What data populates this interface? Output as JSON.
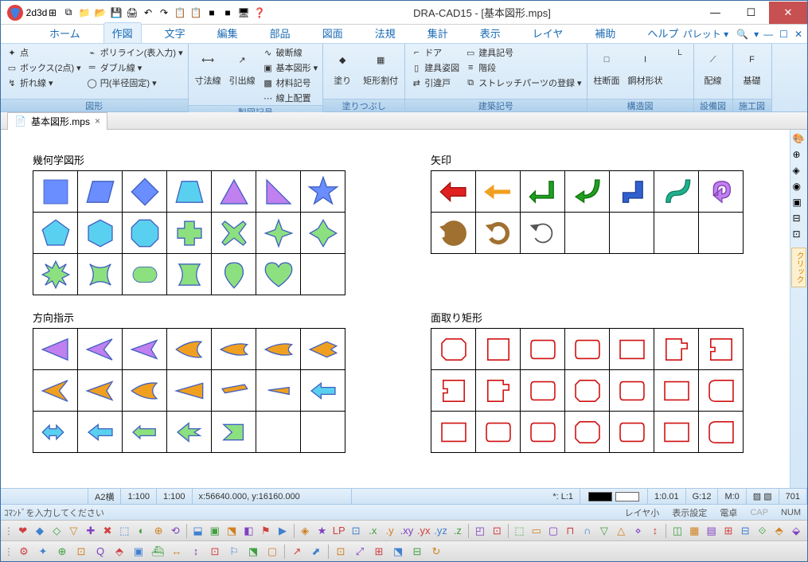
{
  "window": {
    "title": "DRA-CAD15 - [基本図形.mps]",
    "min": "—",
    "max": "☐",
    "close": "✕"
  },
  "qat": [
    "2d3d",
    "⊞",
    "⧉",
    "📁",
    "📂",
    "💾",
    "🖨",
    "↶",
    "↷",
    "📋",
    "📋",
    "■",
    "■",
    "🖥",
    "❓"
  ],
  "tabs": [
    "ホーム",
    "作図",
    "文字",
    "編集",
    "部品",
    "図面",
    "法規",
    "集計",
    "表示",
    "レイヤ",
    "補助",
    "ヘルプ"
  ],
  "active_tab": 1,
  "palette_label": "パレット",
  "ribbon": {
    "groups": [
      {
        "name": "図形",
        "items": [
          {
            "label": "点",
            "ico": "✦"
          },
          {
            "label": "ボックス(2点)",
            "ico": "▭",
            "dd": true
          },
          {
            "label": "折れ線",
            "ico": "↯",
            "dd": true
          },
          {
            "label": "ポリライン(表入力)",
            "ico": "⌁",
            "dd": true
          },
          {
            "label": "ダブル線",
            "ico": "═",
            "dd": true
          },
          {
            "label": "円(半径固定)",
            "ico": "◯",
            "dd": true
          }
        ]
      },
      {
        "name": "製図記号",
        "big": [
          {
            "label": "寸法線",
            "ico": "⟷"
          },
          {
            "label": "引出線",
            "ico": "↗"
          }
        ],
        "items": [
          {
            "label": "破断線",
            "ico": "∿"
          },
          {
            "label": "基本図形",
            "ico": "▣",
            "dd": true
          },
          {
            "label": "材料記号",
            "ico": "▩"
          },
          {
            "label": "線上配置",
            "ico": "⋯"
          }
        ]
      },
      {
        "name": "塗りつぶし",
        "big": [
          {
            "label": "塗り",
            "ico": "◆"
          },
          {
            "label": "矩形割付",
            "ico": "▦"
          }
        ]
      },
      {
        "name": "建築記号",
        "items": [
          {
            "label": "ドア",
            "ico": "⌐"
          },
          {
            "label": "建具姿図",
            "ico": "▯"
          },
          {
            "label": "引違戸",
            "ico": "⇄"
          },
          {
            "label": "建具記号",
            "ico": "▭"
          },
          {
            "label": "階段",
            "ico": "≡"
          },
          {
            "label": "ストレッチパーツの登録",
            "ico": "⧉",
            "dd": true
          }
        ]
      },
      {
        "name": "構造図",
        "big": [
          {
            "label": "柱断面",
            "ico": "□"
          },
          {
            "label": "鋼材形状",
            "ico": "I"
          }
        ],
        "side": {
          "ico": "└"
        }
      },
      {
        "name": "設備図",
        "big": [
          {
            "label": "配線",
            "ico": "⟋"
          }
        ]
      },
      {
        "name": "施工図",
        "big": [
          {
            "label": "基礎",
            "ico": "F"
          }
        ]
      }
    ]
  },
  "doc_tab": {
    "name": "基本図形.mps",
    "close": "×"
  },
  "sections": {
    "geom": {
      "title": "幾何学図形"
    },
    "arrows": {
      "title": "矢印"
    },
    "direction": {
      "title": "方向指示"
    },
    "chamfer": {
      "title": "面取り矩形"
    }
  },
  "status1": {
    "paper": "A2横",
    "scale1": "1:100",
    "scale2": "1:100",
    "coord": "x:56640.000, y:16160.000",
    "layer": "*: L:1",
    "ratio": "1:0.01",
    "grid": "G:12",
    "m": "M:0",
    "count": "701"
  },
  "status2": {
    "prompt": "ｺﾏﾝﾄﾞを入力してください",
    "layer_small": "レイヤ小",
    "disp": "表示設定",
    "calc": "電卓",
    "cap": "CAP",
    "num": "NUM"
  },
  "toolbar1_count": 45,
  "toolbar2_count": 24,
  "colors": {
    "blue": "#6a8dff",
    "cyan": "#5ad0f0",
    "green": "#8de080",
    "purple": "#c080f0",
    "orange": "#f0a020",
    "red": "#e02020",
    "teal": "#20b090",
    "brown": "#a07030"
  },
  "chart_data": {
    "type": "table",
    "note": "Shape palette UI — four grids of selectable shape thumbnails",
    "grids": {
      "幾何学図形": {
        "rows": 3,
        "cols": 7,
        "shapes": [
          "square",
          "parallelogram",
          "diamond",
          "trapezoid",
          "triangle",
          "right-triangle",
          "star",
          "pentagon",
          "hexagon",
          "octagon",
          "plus",
          "x-cross",
          "4point-star",
          "4point-concave",
          "burst",
          "curved-star",
          "rounded-rect",
          "hourglass",
          "spade",
          "heart",
          ""
        ]
      },
      "矢印": {
        "rows": 2,
        "cols": 7,
        "shapes": [
          "block-arrow-left-red",
          "line-arrow-left-orange",
          "L-arrow-green",
          "U-arrow-green",
          "S-arrow-blue",
          "S-arrow-teal",
          "U-turn-purple",
          "circular-brown",
          "circular-open-brown",
          "circular-thin",
          "",
          "",
          "",
          ""
        ]
      },
      "方向指示": {
        "rows": 3,
        "cols": 7,
        "shapes-per-row": [
          "7 purple/orange pointers",
          "6 orange/cyan pointers+1",
          "5 cyan/green pointers+2 blank"
        ]
      },
      "面取り矩形": {
        "rows": 3,
        "cols": 7,
        "shapes": "21 red-outline rounded/chamfered rectangle variants"
      }
    }
  }
}
